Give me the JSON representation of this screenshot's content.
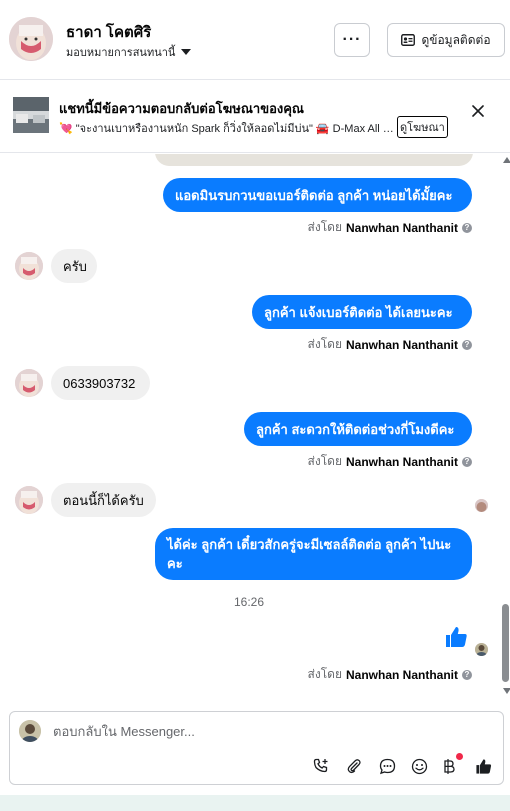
{
  "header": {
    "contact_name": "ธาดา โคตศิริ",
    "assign_label": "มอบหมายการสนทนานี้",
    "more_label": "···",
    "contact_info_label": "ดูข้อมูลติดต่อ"
  },
  "ad_banner": {
    "title": "แชทนี้มีข้อความตอบกลับต่อโฆษณาของคุณ",
    "subtitle": "💘 \"จะงานเบาหรืองานหนัก Spark ก็วิ่งให้ลอดไม่มีบ่น\" 🚘 D-Max All N...",
    "link_label": "ดูโฆษณา"
  },
  "messages": [
    {
      "direction": "out",
      "text": "แอดมินรบกวนขอเบอร์ติดต่อ ลูกค้า หน่อยได้มั้ยคะ"
    },
    {
      "direction": "in",
      "text": "ครับ"
    },
    {
      "direction": "out",
      "text": "ลูกค้า แจ้งเบอร์ติดต่อ ได้เลยนะคะ"
    },
    {
      "direction": "in",
      "text": "0633903732"
    },
    {
      "direction": "out",
      "text": "ลูกค้า สะดวกให้ติดต่อช่วงกี่โมงดีคะ"
    },
    {
      "direction": "in",
      "text": "ตอนนี้ก็ได้ครับ"
    },
    {
      "direction": "out",
      "text": "ได้ค่ะ  ลูกค้า เดี๋ยวสักครู่จะมีเซลล์ติดต่อ ลูกค้า ไปนะคะ"
    }
  ],
  "sent_by": {
    "prefix": "ส่งโดย",
    "name": "Nanwhan Nanthanit"
  },
  "timestamp": "16:26",
  "composer": {
    "placeholder": "ตอบกลับใน Messenger..."
  },
  "colors": {
    "outgoing_bubble": "#0a7cff",
    "incoming_bubble": "#f0f0f0",
    "like_icon": "#0a7cff",
    "notification_dot": "#f02849"
  },
  "icons": {
    "composer_tools": [
      "add-call-icon",
      "attach-icon",
      "chat-bubble-icon",
      "emoji-icon",
      "baht-icon",
      "thumbs-up-icon"
    ]
  }
}
